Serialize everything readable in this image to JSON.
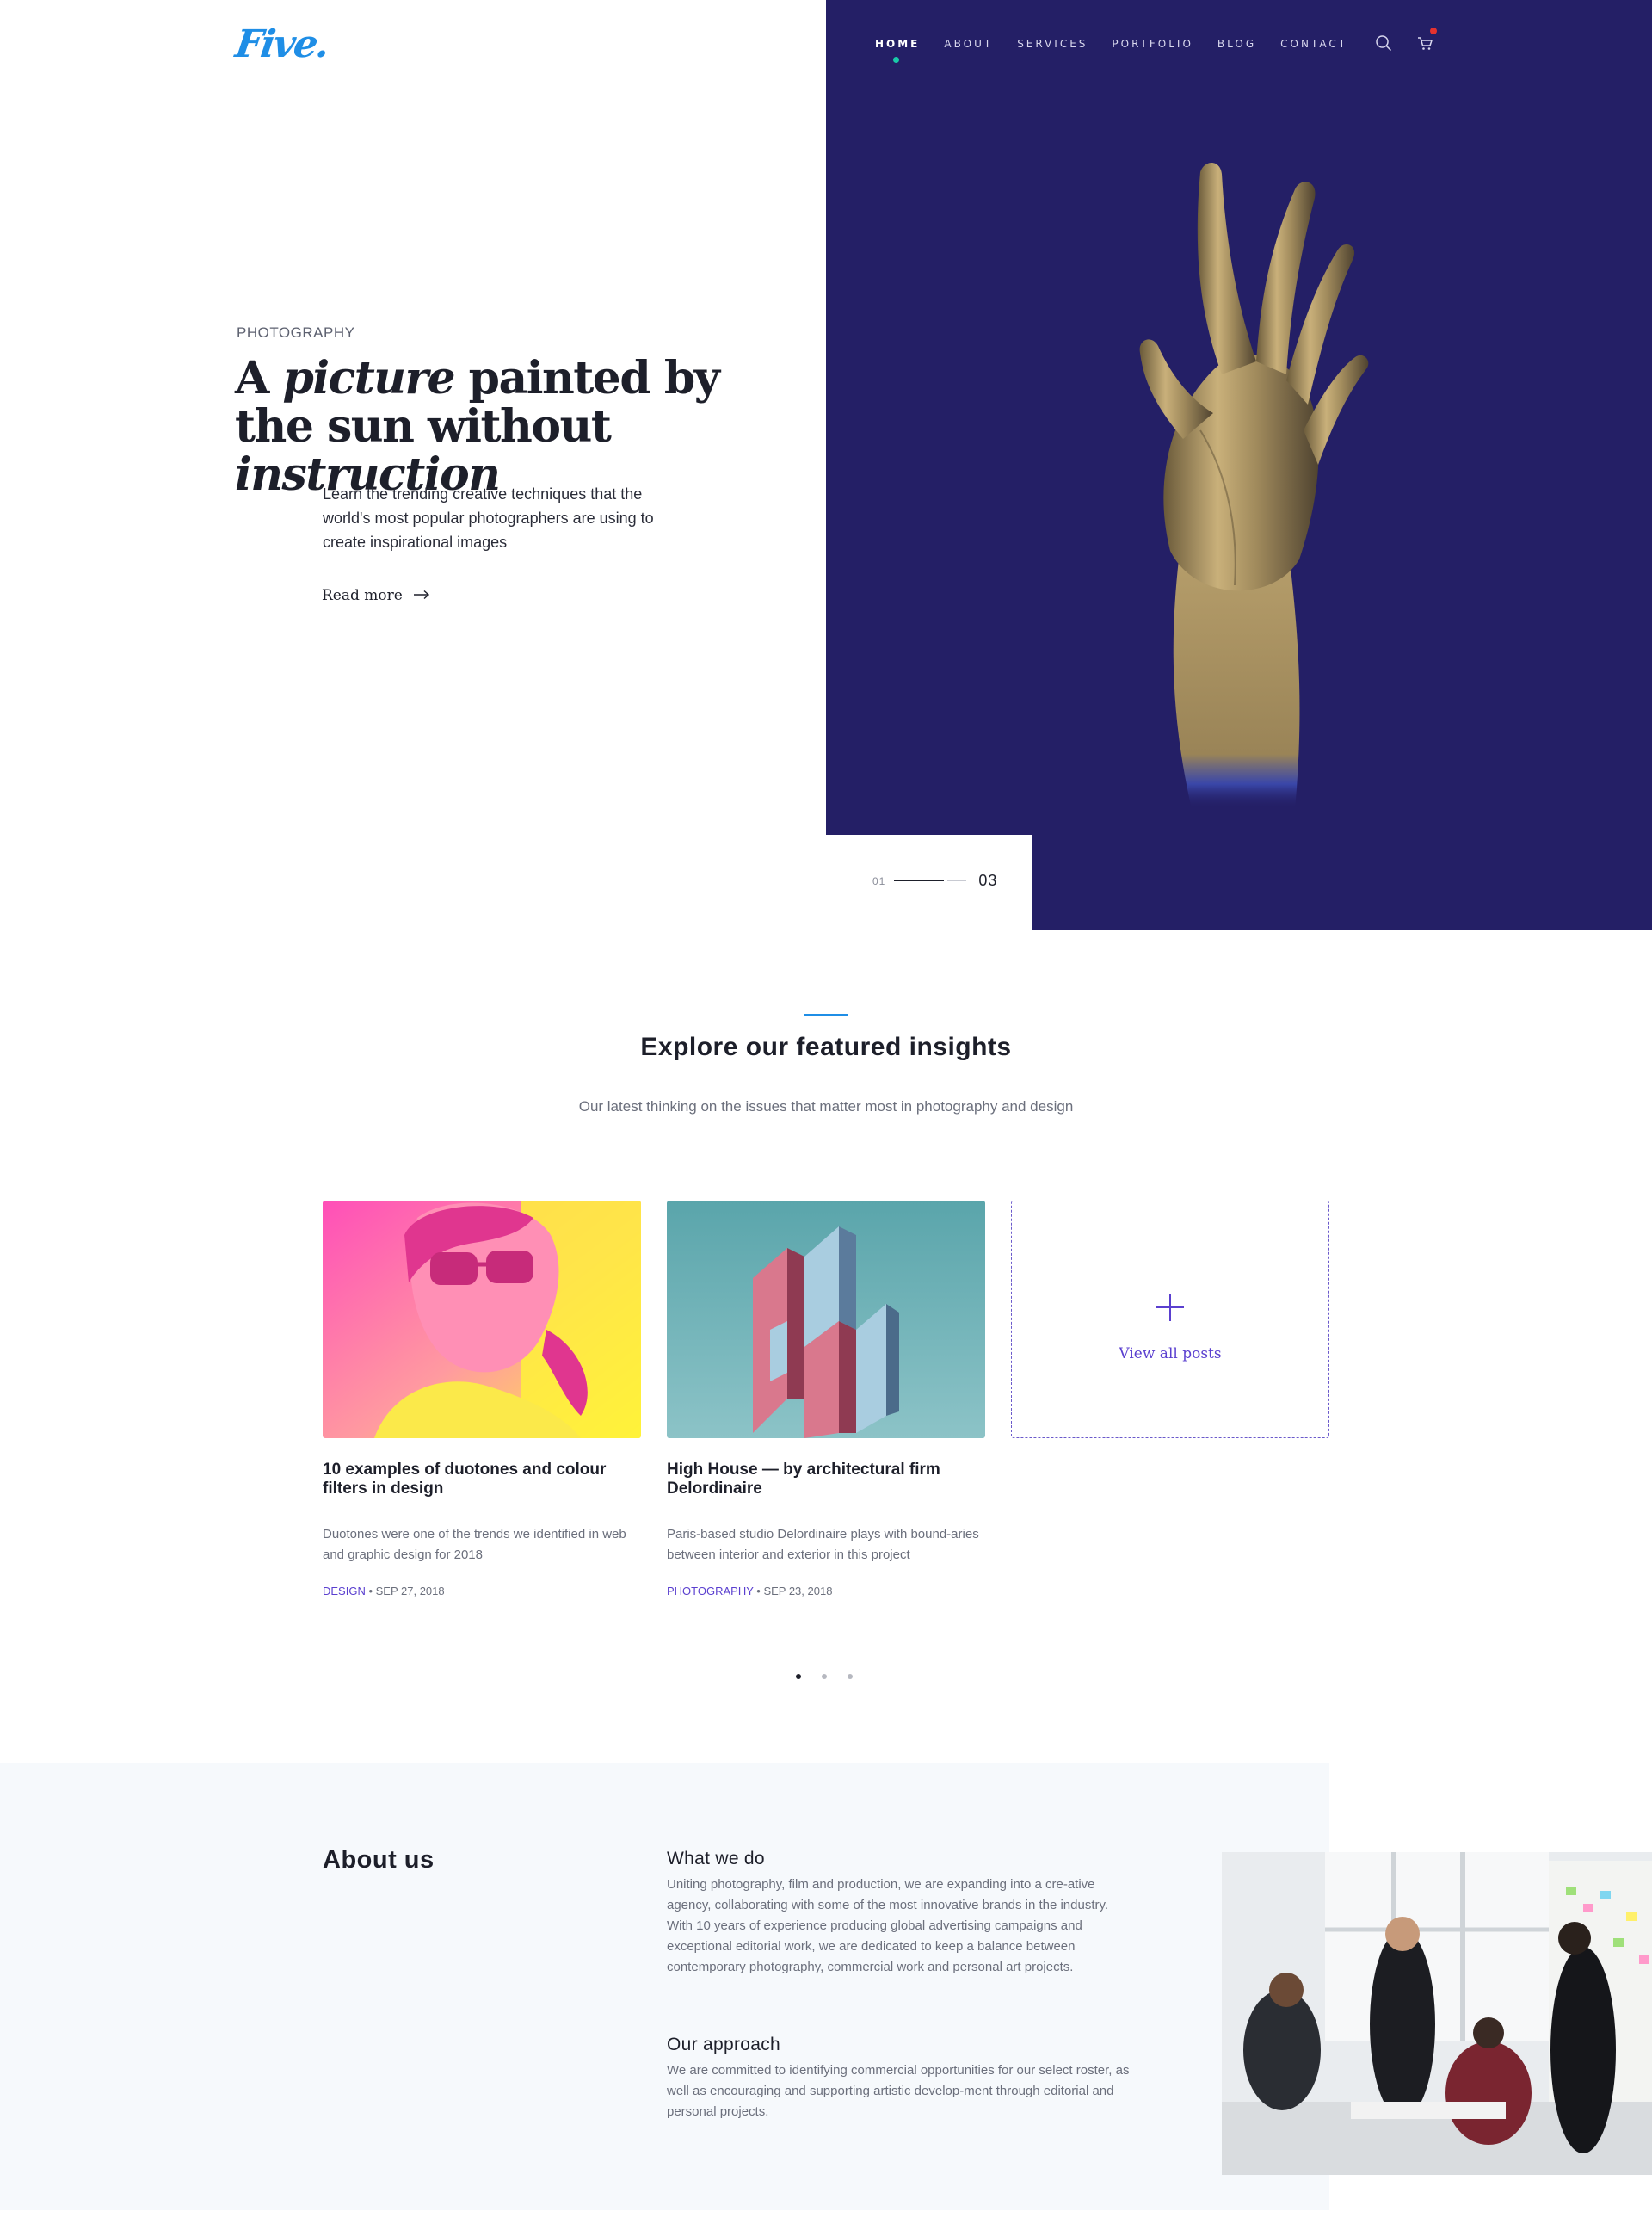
{
  "brand": {
    "logo_text": "Five.",
    "accent": "#1f8ee6",
    "hero_bg": "#241f66",
    "link_color": "#5a3fcf"
  },
  "nav": {
    "items": [
      {
        "label": "HOME",
        "active": true
      },
      {
        "label": "ABOUT"
      },
      {
        "label": "SERVICES"
      },
      {
        "label": "PORTFOLIO"
      },
      {
        "label": "BLOG"
      },
      {
        "label": "CONTACT"
      }
    ],
    "icons": [
      "search-icon",
      "cart-icon"
    ]
  },
  "hero": {
    "category": "PHOTOGRAPHY",
    "title_part1": "A ",
    "title_em1": "picture",
    "title_part2": " painted by the sun without ",
    "title_em2": "instruction",
    "description": "Learn the trending creative techniques that the world's most popular photographers are using to create inspirational images",
    "read_more": "Read more",
    "slider_current": "01",
    "slider_total": "03"
  },
  "insights": {
    "title": "Explore our featured insights",
    "subtitle": "Our latest thinking on the issues that matter most in photography and design",
    "cards": [
      {
        "title": "10 examples of duotones and colour filters in design",
        "excerpt": "Duotones were one of the trends we identified in web and graphic design for 2018",
        "category": "DESIGN",
        "date": "SEP 27, 2018"
      },
      {
        "title": "High House — by architectural firm Delordinaire",
        "excerpt": "Paris-based studio Delordinaire plays with bound-aries between interior and exterior in this project",
        "category": "PHOTOGRAPHY",
        "date": "SEP 23, 2018"
      }
    ],
    "view_all": "View all posts",
    "pager_active": 1,
    "pager_count": 3
  },
  "about": {
    "title": "About us",
    "what_we_do_title": "What we do",
    "what_we_do_text": "Uniting photography, film and production, we are expanding into a cre-ative agency, collaborating with some of the most innovative brands in the industry. With 10 years of experience producing global advertising campaigns and exceptional editorial work, we are dedicated to keep a balance between contemporary photography, commercial work and personal art projects.",
    "approach_title": "Our approach",
    "approach_text": "We are committed to identifying commercial opportunities for our select roster, as well as encouraging and supporting artistic develop-ment through editorial and personal projects."
  }
}
